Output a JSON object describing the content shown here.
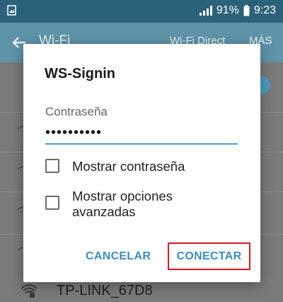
{
  "status_bar": {
    "battery": "91%",
    "time": "9:23"
  },
  "app_bar": {
    "title": "Wi-Fi",
    "wifi_direct": "Wi-Fi Direct",
    "more": "MÁS"
  },
  "network_row": {
    "name": "TP-LINK_67D8"
  },
  "dialog": {
    "title": "WS-Signin",
    "password_label": "Contraseña",
    "password_value": "••••••••••",
    "show_password": "Mostrar contraseña",
    "show_advanced_line1": "Mostrar opciones",
    "show_advanced_line2": "avanzadas",
    "cancel": "CANCELAR",
    "connect": "CONECTAR"
  },
  "colors": {
    "accent": "#4aa3d2",
    "button_text": "#3d8fb8",
    "highlight": "#d8191e",
    "app_bar": "#5f93a8"
  }
}
